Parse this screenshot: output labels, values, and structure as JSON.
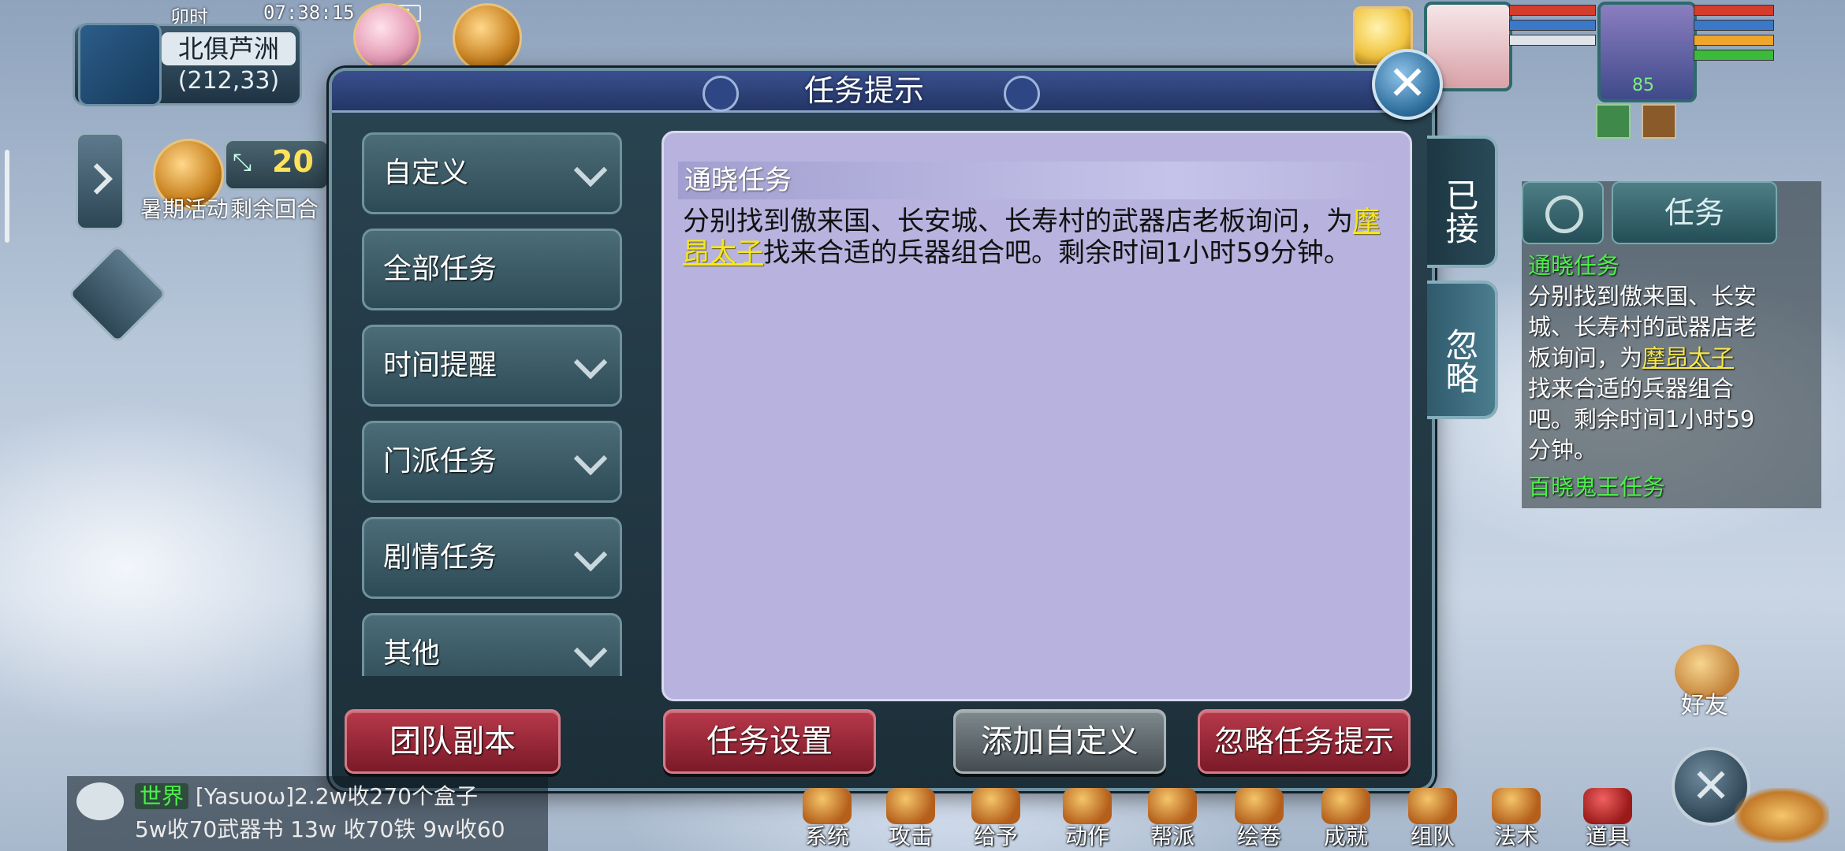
{
  "status": {
    "shichen": "卯时",
    "clock": "07:38:15",
    "map_name": "北俱芦洲",
    "map_coord": "(212,33)"
  },
  "hud": {
    "activity_label": "暑期活动",
    "rounds_value": "20",
    "rounds_label": "剩余回合",
    "level_value": "85"
  },
  "dialog": {
    "title": "任务提示",
    "categories": [
      {
        "label": "自定义",
        "chevron": true
      },
      {
        "label": "全部任务",
        "chevron": false
      },
      {
        "label": "时间提醒",
        "chevron": true
      },
      {
        "label": "门派任务",
        "chevron": true
      },
      {
        "label": "剧情任务",
        "chevron": true
      },
      {
        "label": "其他",
        "chevron": true
      }
    ],
    "detail": {
      "title": "通晓任务",
      "text_before": "分别找到傲来国、长安城、长寿村的武器店老板询问，为",
      "link": "摩昂太子",
      "text_after": "找来合适的兵器组合吧。剩余时间1小时59分钟。"
    },
    "side_tabs": {
      "accepted": "已接",
      "ignored": "忽略"
    },
    "buttons": {
      "team_dungeon": "团队副本",
      "task_settings": "任务设置",
      "add_custom": "添加自定义",
      "ignore_hint": "忽略任务提示"
    }
  },
  "tracker": {
    "tab_task": "任务",
    "task1_title": "通晓任务",
    "task1_before": "分别找到傲来国、长安城、长寿村的武器店老板询问，为",
    "task1_link": "摩昂太子",
    "task1_after": "找来合适的兵器组合吧。剩余时间1小时59分钟。",
    "task2_title": "百晓鬼王任务"
  },
  "chat": {
    "channel": "世界",
    "line1": "[Yasuoω]2.2w收270个盒子",
    "line2": "5w收70武器书 13w 收70铁 9w收60"
  },
  "toolbar": {
    "items": [
      "系统",
      "攻击",
      "给予",
      "动作",
      "帮派",
      "绘卷",
      "成就",
      "组队",
      "法术",
      "道具"
    ],
    "friends": "好友"
  },
  "colors": {
    "dialog_bg": "#1c2f39",
    "detail_bg": "#b7b3de",
    "link_yellow": "#f5e71e",
    "task_green": "#4cf04a",
    "red_button": "#7a1a28"
  }
}
